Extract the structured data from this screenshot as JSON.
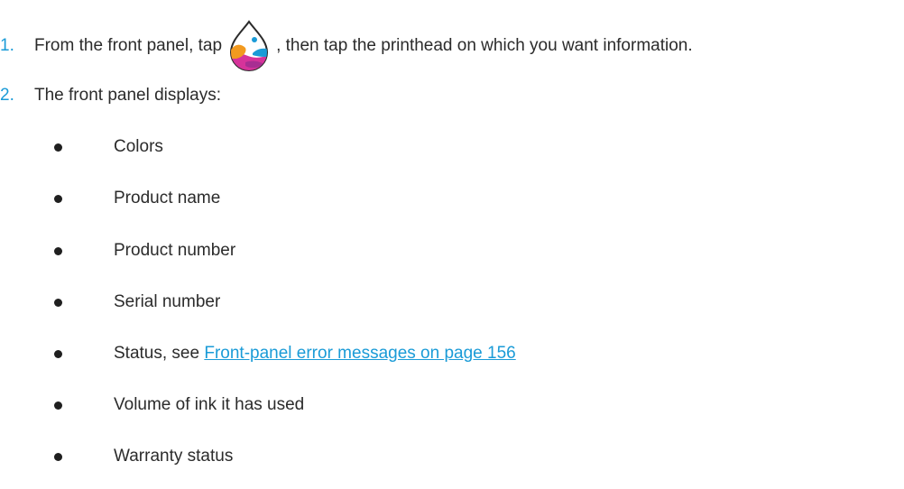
{
  "steps": [
    {
      "number": "1.",
      "text_before": "From the front panel, tap",
      "icon": "ink-drop-icon",
      "text_after": ", then tap the printhead on which you want information."
    },
    {
      "number": "2.",
      "text": "The front panel displays:"
    }
  ],
  "bullets": [
    {
      "text": "Colors"
    },
    {
      "text": "Product name"
    },
    {
      "text": "Product number"
    },
    {
      "text": "Serial number"
    },
    {
      "text": "Status, see ",
      "link": "Front-panel error messages on page 156"
    },
    {
      "text": "Volume of ink it has used"
    },
    {
      "text": "Warranty status"
    }
  ],
  "colors": {
    "accent": "#1a9bd7",
    "text": "#2b2b2b",
    "icon_magenta": "#d6339a",
    "icon_orange": "#f29a1f",
    "icon_blue": "#1a9bd7"
  }
}
